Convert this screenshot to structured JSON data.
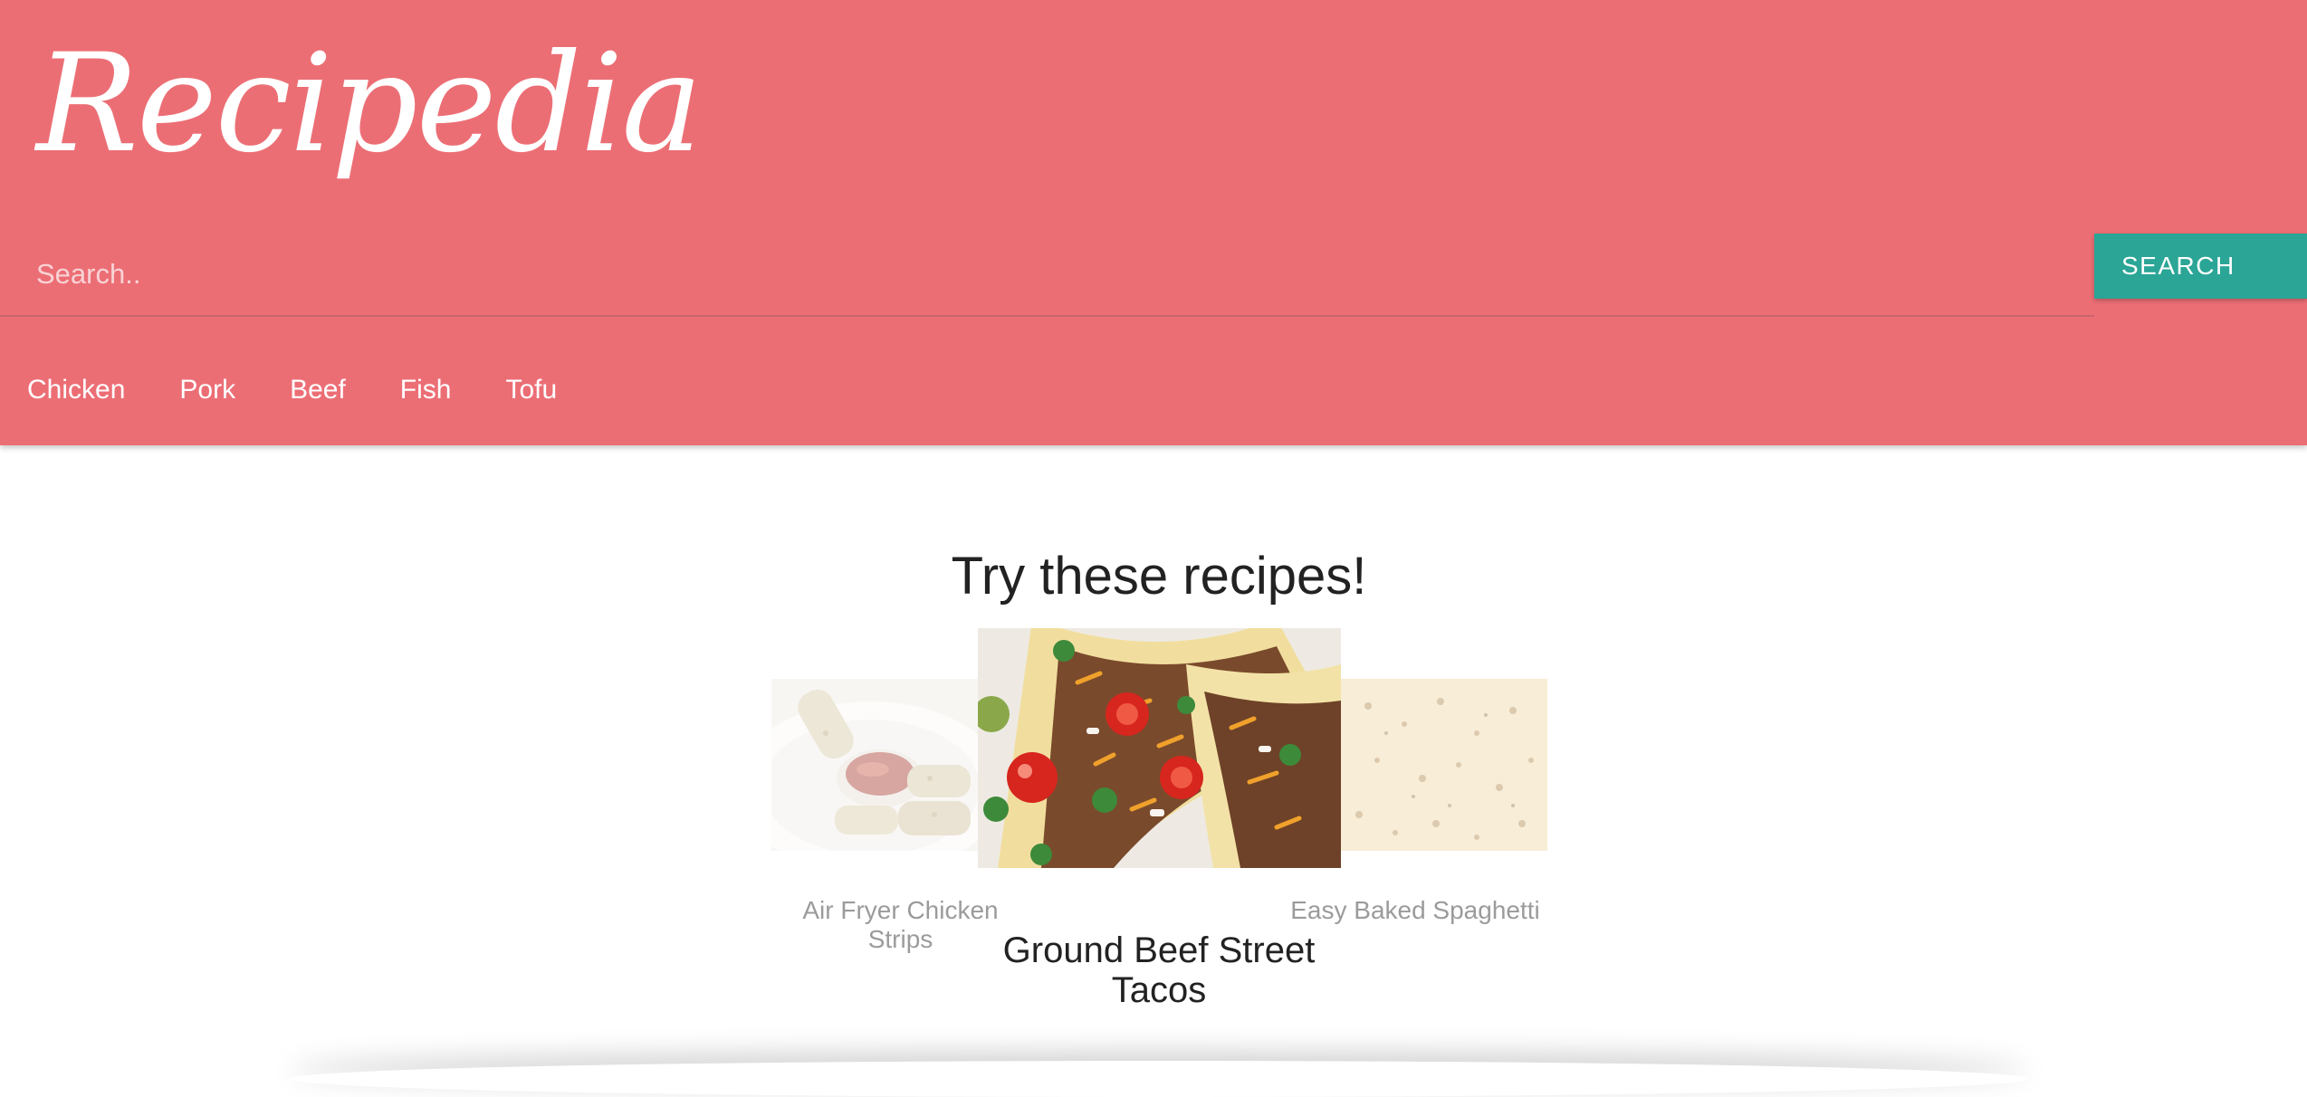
{
  "header": {
    "logo_text": "Recipedia",
    "bg_color": "#ec6e75"
  },
  "search": {
    "placeholder": "Search..",
    "value": "",
    "button_label": "SEARCH",
    "button_color": "#2ba596"
  },
  "categories": [
    "Chicken",
    "Pork",
    "Beef",
    "Fish",
    "Tofu"
  ],
  "main": {
    "title": "Try these recipes!"
  },
  "carousel": {
    "items": [
      {
        "title": "Air Fryer Chicken Strips",
        "image": "chicken-strips-image",
        "state": "previous"
      },
      {
        "title": "Ground Beef Street Tacos",
        "image": "tacos-image",
        "state": "active"
      },
      {
        "title": "Easy Baked Spaghetti",
        "image": "baked-spaghetti-image",
        "state": "next"
      }
    ]
  }
}
